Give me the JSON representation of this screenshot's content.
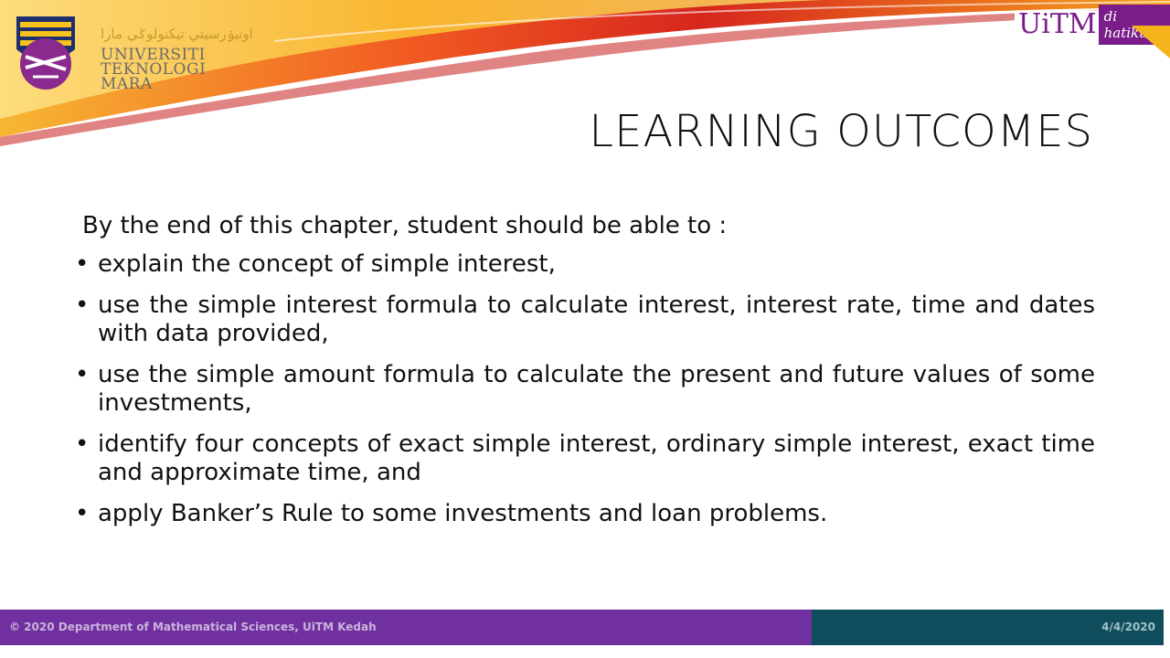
{
  "header": {
    "jawi_text": "اونيۏرسيتي تيكنولوݢي مارا",
    "university_line1": "UNIVERSITI",
    "university_line2": "TEKNOLOGI",
    "university_line3": "MARA",
    "badge_main": "UiTM",
    "badge_tag": "di hatiku"
  },
  "slide": {
    "title": "LEARNING OUTCOMES",
    "intro": "By the end of this chapter, student should be able to :",
    "bullets": [
      "explain the concept of simple interest,",
      "use the simple interest formula to calculate interest, interest rate, time and dates with data provided,",
      "use the simple amount formula to calculate the present and future values of some investments,",
      "identify four concepts of exact simple interest, ordinary simple interest, exact time and approximate time, and",
      "apply Banker’s Rule to some investments and loan problems."
    ]
  },
  "footer": {
    "copyright": "© 2020 Department of Mathematical Sciences, UiTM Kedah",
    "date": "4/4/2020"
  },
  "colors": {
    "purple": "#7030a0",
    "teal": "#0f4c5c",
    "red": "#d7261e",
    "orange": "#f6a21b"
  }
}
